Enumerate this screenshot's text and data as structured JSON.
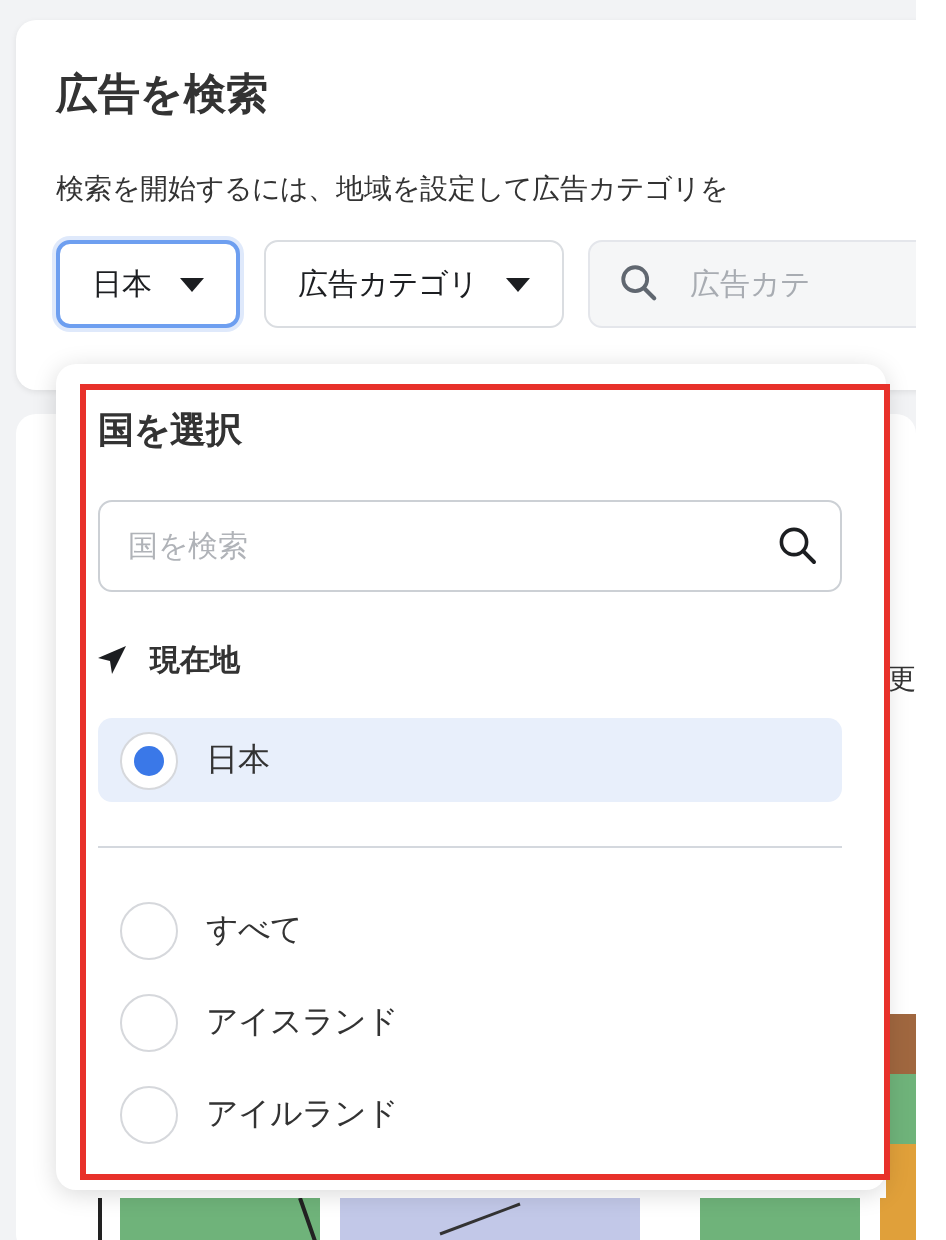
{
  "title": "広告を検索",
  "description": "検索を開始するには、地域を設定して広告カテゴリを",
  "filters": {
    "country": {
      "label": "日本",
      "open": true
    },
    "category": {
      "label": "広告カテゴリ",
      "open": false
    },
    "search": {
      "placeholder": "広告カテ"
    }
  },
  "background_text": "更",
  "dropdown": {
    "title": "国を選択",
    "search": {
      "placeholder": "国を検索"
    },
    "current_location": {
      "heading": "現在地",
      "option": {
        "label": "日本",
        "selected": true
      }
    },
    "options": [
      {
        "label": "すべて",
        "selected": false
      },
      {
        "label": "アイスランド",
        "selected": false
      },
      {
        "label": "アイルランド",
        "selected": false
      }
    ]
  },
  "annotation": {
    "highlighted": true
  }
}
